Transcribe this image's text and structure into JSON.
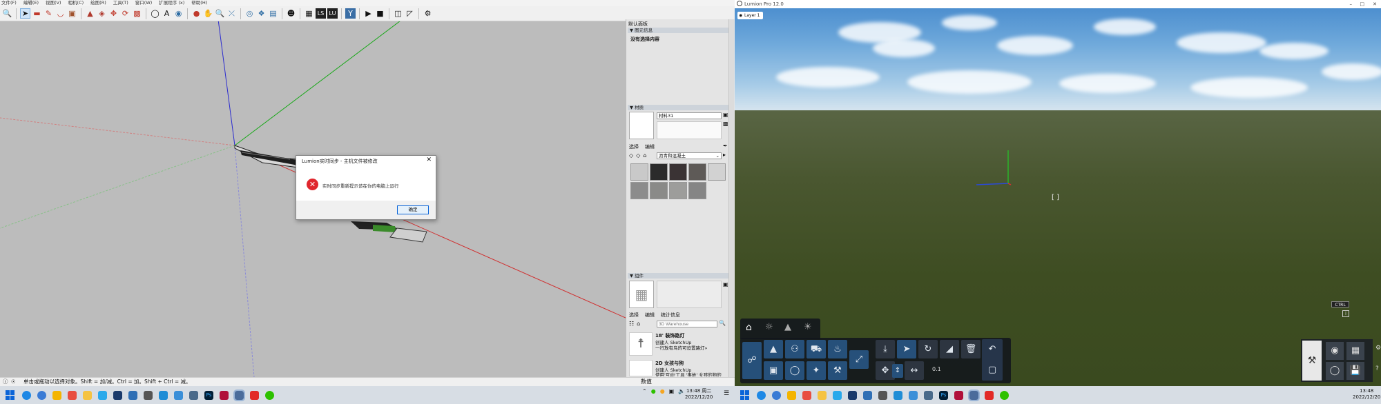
{
  "sketchup": {
    "menu": [
      "文件(F)",
      "编辑(E)",
      "视图(V)",
      "相机(C)",
      "绘图(R)",
      "工具(T)",
      "窗口(W)",
      "扩展程序 (x)",
      "帮助(H)"
    ],
    "status_text": "单击或拖动以选择对象。Shift = 加/减。Ctrl = 加。Shift + Ctrl = 减。",
    "measure_label": "数值",
    "dialog": {
      "title": "Lumion实时同步 - 主机文件被修改",
      "message": "实时同步重新提示该在你的电脑上运行",
      "ok": "确定",
      "close": "✕"
    },
    "tray": {
      "title": "默认面板",
      "entity_info": "图元信息",
      "entity_empty": "没有选择内容",
      "materials": "材质",
      "material_name": "材料31",
      "tab_select": "选择",
      "tab_edit": "编辑",
      "material_category": "沥青和混凝土",
      "components": "组件",
      "comp_tab_select": "选择",
      "comp_tab_edit": "编辑",
      "comp_tab_stats": "统计信息",
      "warehouse_placeholder": "3D Warehouse",
      "items": [
        {
          "title": "18' 装饰路灯",
          "line1": "创建人 SketchUp",
          "line2": "一行放有鸟的可设置路灯»"
        },
        {
          "title": "2D 女孩与狗",
          "line1": "创建人 SketchUp",
          "line2": "使用'互动'工具 '事故' 女孩的狗的"
        }
      ]
    },
    "taskbar": {
      "time": "13:48 周二",
      "date": "2022/12/20",
      "icons": [
        "search-icon",
        "edge-icon",
        "explorer-icon",
        "folder-icon",
        "telegram-icon",
        "sketchup-icon",
        "app-icon",
        "wechat-icon",
        "app-icon",
        "app-icon",
        "app-icon",
        "photoshop-icon",
        "app-icon",
        "app-icon",
        "acrobat-icon",
        "wechat-icon"
      ]
    }
  },
  "lumion": {
    "title": "Lumion Pro 12.0",
    "layer": "Layer 1",
    "ctrl": "CTRL",
    "height_value": "0.1",
    "taskbar": {
      "time": "13:48",
      "date": "2022/12/20"
    }
  },
  "colors": {
    "accent": "#0a64d8",
    "error": "#e0262d",
    "lumion_blue": "#26507a"
  }
}
